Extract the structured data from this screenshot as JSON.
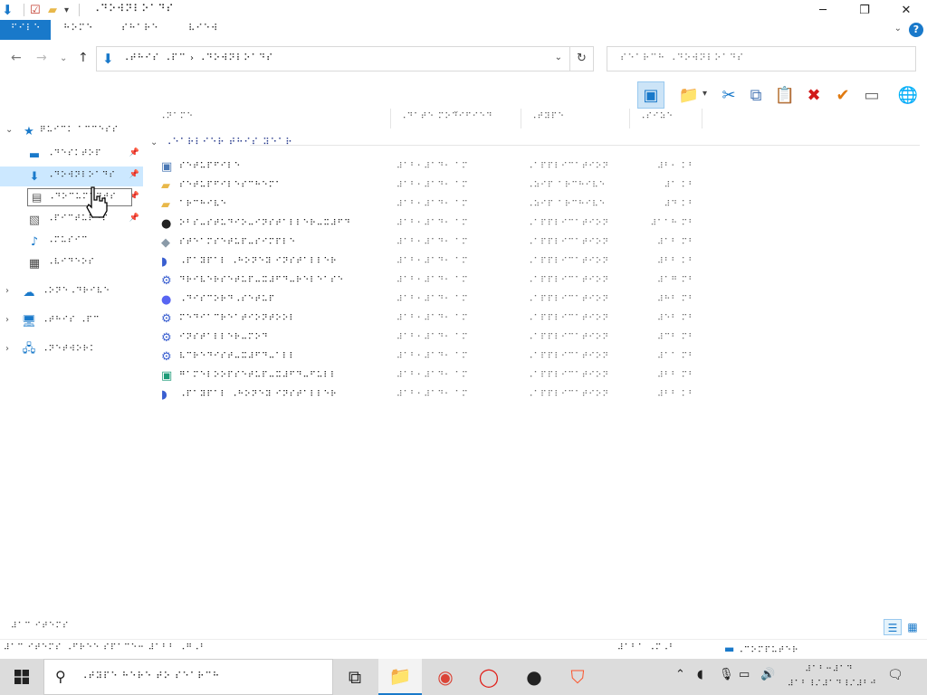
{
  "window": {
    "title": "⠠⠙⠕⠺⠝⠇⠕⠁⠙⠎",
    "minimize_glyph": "─",
    "restore_glyph": "❐",
    "close_glyph": "✕",
    "qa_dropdown_glyph": "▾"
  },
  "ribbon": {
    "tabs": [
      "⠋⠊⠇⠑",
      "⠓⠕⠍⠑",
      "⠎⠓⠁⠗⠑",
      "⠧⠊⠑⠺"
    ],
    "active_index": 0,
    "collapse_glyph": "⌄",
    "help_glyph": "?"
  },
  "address": {
    "back": "←",
    "forward": "→",
    "recent": "⌄",
    "up": "↑",
    "path": "⠠⠞⠓⠊⠎ ⠠⠏⠉  ›  ⠠⠙⠕⠺⠝⠇⠕⠁⠙⠎",
    "dropdown_glyph": "⌄",
    "refresh_glyph": "↻",
    "search_placeholder": "⠎⠑⠁⠗⠉⠓ ⠠⠙⠕⠺⠝⠇⠕⠁⠙⠎"
  },
  "toolbar": {
    "buttons": [
      {
        "name": "preview-pane-icon",
        "glyph": "▣",
        "color": "#1979ca",
        "selected": true
      },
      {
        "name": "new-folder-icon",
        "glyph": "📁",
        "color": "#e8b84a"
      },
      {
        "name": "cut-icon",
        "glyph": "✂",
        "color": "#1979ca"
      },
      {
        "name": "copy-icon",
        "glyph": "⧉",
        "color": "#4a78b5"
      },
      {
        "name": "paste-icon",
        "glyph": "📋",
        "color": "#6a6a6a"
      },
      {
        "name": "delete-icon",
        "glyph": "✖",
        "color": "#d11a1a"
      },
      {
        "name": "checkmark-icon",
        "glyph": "✔",
        "color": "#e07a10"
      },
      {
        "name": "rename-icon",
        "glyph": "▭",
        "color": "#6a6a6a"
      },
      {
        "name": "globe-icon",
        "glyph": "🌐",
        "color": "#3aa0d8"
      }
    ],
    "dropdown_glyph": "▾"
  },
  "nav": {
    "quick_access": "⠟⠥⠊⠉⠅ ⠁⠉⠉⠑⠎⠎",
    "items": [
      {
        "label": "⠠⠙⠑⠎⠅⠞⠕⠏",
        "icon": "desktop-icon",
        "glyph": "▬",
        "color": "#1979ca",
        "pinned": true,
        "selected": false
      },
      {
        "label": "⠠⠙⠕⠺⠝⠇⠕⠁⠙⠎",
        "icon": "downloads-icon",
        "glyph": "⬇",
        "color": "#1979ca",
        "pinned": true,
        "selected": true
      },
      {
        "label": "⠠⠙⠕⠉⠥⠍⠑⠝⠞⠎",
        "icon": "documents-icon",
        "glyph": "▤",
        "color": "#666",
        "pinned": true,
        "selected": false
      },
      {
        "label": "⠠⠏⠊⠉⠞⠥⠗⠑⠎",
        "icon": "pictures-icon",
        "glyph": "▧",
        "color": "#666",
        "pinned": true,
        "selected": false
      },
      {
        "label": "⠠⠍⠥⠎⠊⠉",
        "icon": "music-icon",
        "glyph": "♪",
        "color": "#1979ca",
        "pinned": false,
        "selected": false
      },
      {
        "label": "⠠⠧⠊⠙⠑⠕⠎",
        "icon": "videos-icon",
        "glyph": "▦",
        "color": "#444",
        "pinned": false,
        "selected": false
      }
    ],
    "roots": [
      {
        "label": "⠠⠕⠝⠑⠠⠙⠗⠊⠧⠑",
        "icon": "onedrive-icon",
        "glyph": "☁",
        "color": "#1979ca"
      },
      {
        "label": "⠠⠞⠓⠊⠎ ⠠⠏⠉",
        "icon": "this-pc-icon",
        "glyph": "🖥",
        "color": "#1979ca"
      },
      {
        "label": "⠠⠝⠑⠞⠺⠕⠗⠅",
        "icon": "network-icon",
        "glyph": "🖧",
        "color": "#1979ca"
      }
    ],
    "pin_glyph": "📌",
    "star_glyph": "★",
    "expand_glyph": "›",
    "collapse_glyph": "⌄"
  },
  "drag_tooltip": {
    "label": "⠠⠙⠕⠉⠥⠍⠑⠝⠞⠎",
    "glyph": "▤"
  },
  "columns": [
    "⠠⠝⠁⠍⠑",
    "⠠⠙⠁⠞⠑ ⠍⠕⠙⠊⠋⠊⠑⠙",
    "⠠⠞⠽⠏⠑",
    "⠠⠎⠊⠵⠑"
  ],
  "group": {
    "label": "⠠⠑⠁⠗⠇⠊⠑⠗ ⠞⠓⠊⠎ ⠽⠑⠁⠗",
    "collapse_glyph": "⌄"
  },
  "files": [
    {
      "name": "⠎⠑⠞⠥⠏⠋⠊⠇⠑",
      "date": "⠼⠁⠃⠂⠼⠁⠙⠂ ⠁⠍",
      "type": "⠠⠁⠏⠏⠇⠊⠉⠁⠞⠊⠕⠝",
      "size": "⠼⠃⠂ ⠅⠃",
      "icon": "installer-icon",
      "glyph": "▣",
      "color": "#4a78b5"
    },
    {
      "name": "⠎⠑⠞⠥⠏⠋⠊⠇⠑⠎⠉⠓⠑⠍⠁",
      "date": "⠼⠁⠃⠂⠼⠁⠙⠂ ⠁⠍",
      "type": "⠠⠵⠊⠏ ⠁⠗⠉⠓⠊⠧⠑",
      "size": "⠼⠁ ⠅⠃",
      "icon": "archive-icon",
      "glyph": "▰",
      "color": "#e8b84a"
    },
    {
      "name": "⠁⠗⠉⠓⠊⠧⠑",
      "date": "⠼⠁⠃⠂⠼⠁⠙⠂ ⠁⠍",
      "type": "⠠⠵⠊⠏ ⠁⠗⠉⠓⠊⠧⠑",
      "size": "⠼⠙ ⠅⠃",
      "icon": "archive-icon",
      "glyph": "▰",
      "color": "#e8b84a"
    },
    {
      "name": "⠕⠃⠎⠤⠎⠞⠥⠙⠊⠕⠤⠊⠝⠎⠞⠁⠇⠇⠑⠗⠤⠭⠼⠋⠙",
      "date": "⠼⠁⠃⠂⠼⠁⠙⠂ ⠁⠍",
      "type": "⠠⠁⠏⠏⠇⠊⠉⠁⠞⠊⠕⠝",
      "size": "⠼⠁⠁⠓ ⠍⠃",
      "icon": "obs-icon",
      "glyph": "●",
      "color": "#222"
    },
    {
      "name": "⠎⠞⠑⠁⠍⠎⠑⠞⠥⠏⠤⠎⠊⠍⠏⠇⠑",
      "date": "⠼⠁⠃⠂⠼⠁⠙⠂ ⠁⠍",
      "type": "⠠⠁⠏⠏⠇⠊⠉⠁⠞⠊⠕⠝",
      "size": "⠼⠁⠃ ⠍⠃",
      "icon": "steam-icon",
      "glyph": "◆",
      "color": "#8a9aa8"
    },
    {
      "name": "⠠⠏⠁⠽⠏⠁⠇ ⠠⠓⠕⠝⠑⠽ ⠊⠝⠎⠞⠁⠇⠇⠑⠗",
      "date": "⠼⠁⠃⠂⠼⠁⠙⠂ ⠁⠍",
      "type": "⠠⠁⠏⠏⠇⠊⠉⠁⠞⠊⠕⠝",
      "size": "⠼⠃⠃ ⠅⠃",
      "icon": "app-icon",
      "glyph": "◗",
      "color": "#3a5fd0"
    },
    {
      "name": "⠙⠗⠊⠧⠑⠗⠎⠑⠞⠥⠏⠤⠭⠼⠋⠙⠤⠗⠑⠇⠑⠁⠎⠑",
      "date": "⠼⠁⠃⠂⠼⠁⠙⠂ ⠁⠍",
      "type": "⠠⠁⠏⠏⠇⠊⠉⠁⠞⠊⠕⠝",
      "size": "⠼⠁⠛ ⠍⠃",
      "icon": "setup-icon",
      "glyph": "⚙",
      "color": "#3a5fd0"
    },
    {
      "name": "⠠⠙⠊⠎⠉⠕⠗⠙⠠⠎⠑⠞⠥⠏",
      "date": "⠼⠁⠃⠂⠼⠁⠙⠂ ⠁⠍",
      "type": "⠠⠁⠏⠏⠇⠊⠉⠁⠞⠊⠕⠝",
      "size": "⠼⠓⠃ ⠍⠃",
      "icon": "discord-icon",
      "glyph": "●",
      "color": "#5865f2"
    },
    {
      "name": "⠍⠑⠙⠊⠁⠉⠗⠑⠁⠞⠊⠕⠝⠞⠕⠕⠇",
      "date": "⠼⠁⠃⠂⠼⠁⠙⠂ ⠁⠍",
      "type": "⠠⠁⠏⠏⠇⠊⠉⠁⠞⠊⠕⠝",
      "size": "⠼⠑⠃ ⠍⠃",
      "icon": "setup-icon",
      "glyph": "⚙",
      "color": "#3a5fd0"
    },
    {
      "name": "⠊⠝⠎⠞⠁⠇⠇⠑⠗⠤⠍⠕⠙",
      "date": "⠼⠁⠃⠂⠼⠁⠙⠂ ⠁⠍",
      "type": "⠠⠁⠏⠏⠇⠊⠉⠁⠞⠊⠕⠝",
      "size": "⠼⠉⠃ ⠍⠃",
      "icon": "setup-icon",
      "glyph": "⚙",
      "color": "#3a5fd0"
    },
    {
      "name": "⠧⠉⠗⠑⠙⠊⠎⠞⠤⠭⠼⠋⠙⠤⠁⠇⠇",
      "date": "⠼⠁⠃⠂⠼⠁⠙⠂ ⠁⠍",
      "type": "⠠⠁⠏⠏⠇⠊⠉⠁⠞⠊⠕⠝",
      "size": "⠼⠁⠁ ⠍⠃",
      "icon": "setup-icon",
      "glyph": "⚙",
      "color": "#3a5fd0"
    },
    {
      "name": "⠛⠁⠍⠑⠇⠕⠕⠏⠎⠑⠞⠥⠏⠤⠭⠼⠋⠙⠤⠋⠥⠇⠇",
      "date": "⠼⠁⠃⠂⠼⠁⠙⠂ ⠁⠍",
      "type": "⠠⠁⠏⠏⠇⠊⠉⠁⠞⠊⠕⠝",
      "size": "⠼⠃⠃ ⠍⠃",
      "icon": "app-icon",
      "glyph": "▣",
      "color": "#1e9c78"
    },
    {
      "name": "⠠⠏⠁⠽⠏⠁⠇ ⠠⠓⠕⠝⠑⠽ ⠊⠝⠎⠞⠁⠇⠇⠑⠗",
      "date": "⠼⠁⠃⠂⠼⠁⠙⠂ ⠁⠍",
      "type": "⠠⠁⠏⠏⠇⠊⠉⠁⠞⠊⠕⠝",
      "size": "⠼⠃⠃ ⠅⠃",
      "icon": "app-icon",
      "glyph": "◗",
      "color": "#3a5fd0"
    }
  ],
  "status": {
    "count": "⠼⠁⠉ ⠊⠞⠑⠍⠎",
    "details_glyph": "☰",
    "tiles_glyph": "▦",
    "info_left": "⠼⠁⠉ ⠊⠞⠑⠍⠎ ⠠⠋⠗⠑⠑ ⠎⠏⠁⠉⠑⠒ ⠼⠁⠃⠃ ⠠⠛⠠⠃",
    "info_mid": "⠼⠁⠃⠁ ⠠⠍⠠⠃",
    "info_right": "⠠⠉⠕⠍⠏⠥⠞⠑⠗",
    "info_right_glyph": "▬"
  },
  "taskbar": {
    "search_placeholder": "⠠⠞⠽⠏⠑ ⠓⠑⠗⠑ ⠞⠕ ⠎⠑⠁⠗⠉⠓",
    "search_glyph": "⚲",
    "apps": [
      {
        "name": "task-view-icon",
        "glyph": "⧉",
        "color": "#222",
        "active": false
      },
      {
        "name": "file-explorer-icon",
        "glyph": "📁",
        "color": "#e8b84a",
        "active": true
      },
      {
        "name": "chrome-icon",
        "glyph": "◉",
        "color": "#db4437",
        "active": false
      },
      {
        "name": "opera-icon",
        "glyph": "◯",
        "color": "#e0201a",
        "active": false
      },
      {
        "name": "obs-icon",
        "glyph": "●",
        "color": "#222",
        "active": false
      },
      {
        "name": "brave-icon",
        "glyph": "⛉",
        "color": "#fb542b",
        "active": false
      }
    ],
    "tray": [
      {
        "name": "tray-chevron-icon",
        "glyph": "⌃"
      },
      {
        "name": "tray-app-icon",
        "glyph": "◖"
      },
      {
        "name": "microphone-icon",
        "glyph": "🎙"
      },
      {
        "name": "network-tray-icon",
        "glyph": "▭"
      },
      {
        "name": "volume-icon",
        "glyph": "🔊"
      }
    ],
    "clock_time": "⠼⠁⠃⠒⠼⠁⠙",
    "clock_date": "⠼⠁⠃⠸⠌⠼⠁⠙⠸⠌⠼⠃⠚",
    "notifications_glyph": "🗨"
  },
  "colors": {
    "accent": "#1979ca",
    "selection": "#cce8ff",
    "taskbar": "#dcdcdc"
  }
}
